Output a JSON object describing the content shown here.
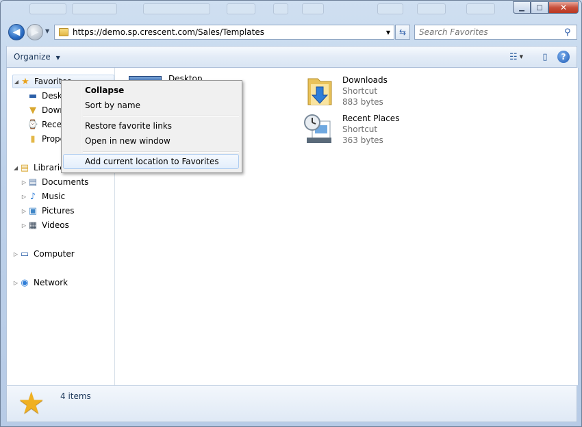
{
  "window": {
    "caption_buttons": {
      "minimize": "▁",
      "maximize": "□",
      "close": "✕"
    }
  },
  "nav": {
    "back_icon": "arrow-left-icon",
    "forward_icon": "arrow-right-icon",
    "address": "https://demo.sp.crescent.com/Sales/Templates",
    "search_placeholder": "Search Favorites"
  },
  "commandbar": {
    "organize_label": "Organize"
  },
  "navpane": {
    "favorites": {
      "label": "Favorites",
      "children": [
        "Desktop",
        "Downloads",
        "Recent Places",
        "Properties"
      ]
    },
    "libraries": {
      "label": "Libraries",
      "children": [
        "Documents",
        "Music",
        "Pictures",
        "Videos"
      ]
    },
    "computer": "Computer",
    "network": "Network"
  },
  "files": [
    {
      "name": "Desktop",
      "type": "",
      "size": ""
    },
    {
      "name": "Downloads",
      "type": "Shortcut",
      "size": "883 bytes"
    },
    {
      "name": "Recent Places",
      "type": "Shortcut",
      "size": "363 bytes"
    }
  ],
  "status": {
    "count": "4 items"
  },
  "context_menu": {
    "collapse": "Collapse",
    "sort_by_name": "Sort by name",
    "restore_links": "Restore favorite links",
    "open_new_window": "Open in new window",
    "add_location": "Add current location to Favorites"
  },
  "colors": {
    "accent": "#2a6bc2",
    "menu_highlight": "#e3eefc",
    "folder": "#e3b747"
  }
}
